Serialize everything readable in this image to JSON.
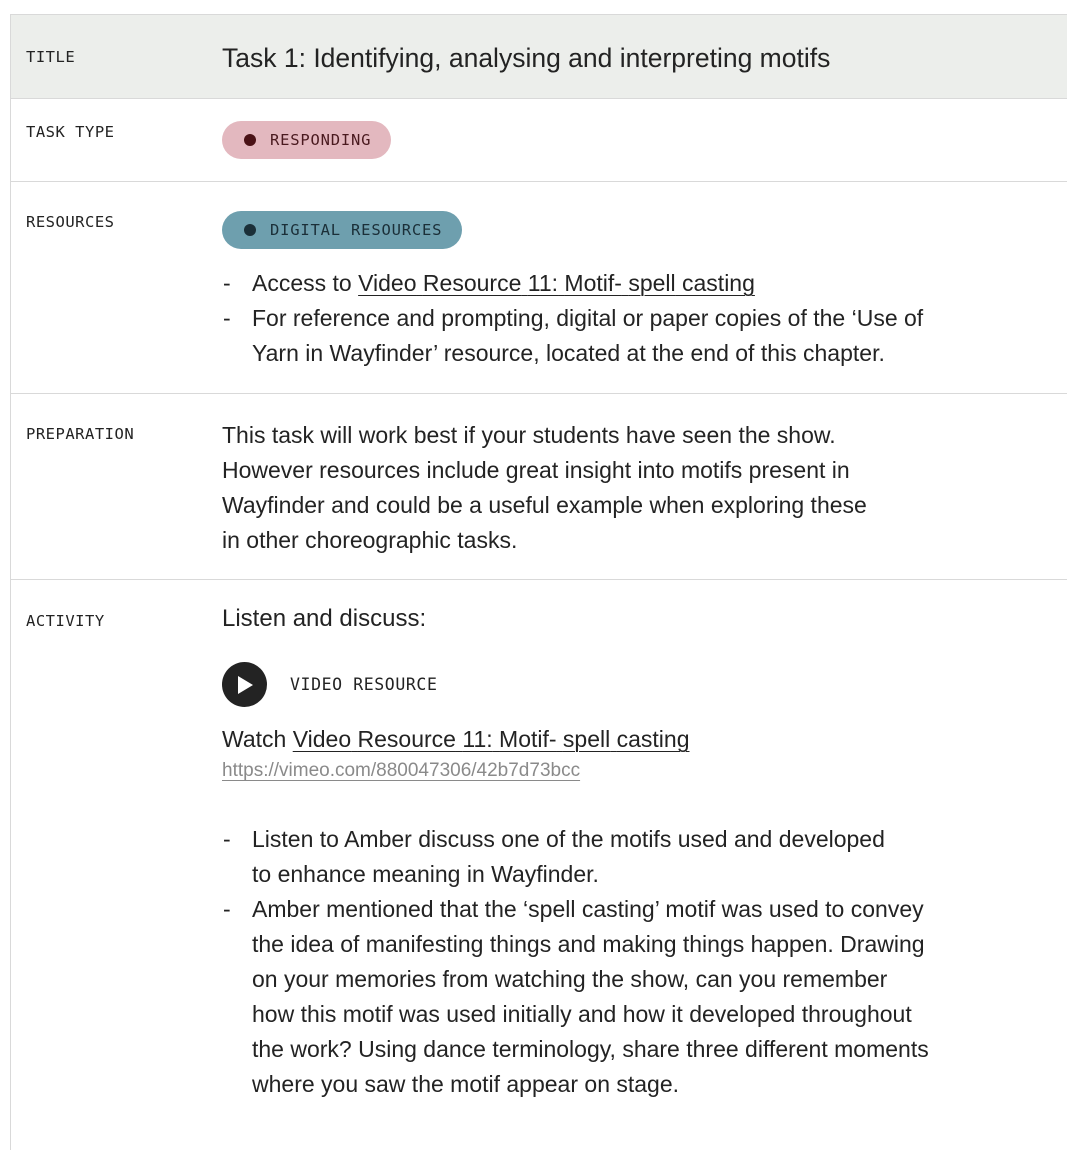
{
  "title": {
    "label": "TITLE",
    "text": "Task 1: Identifying, analysing and interpreting motifs"
  },
  "task_type": {
    "label": "TASK TYPE",
    "pill": "RESPONDING"
  },
  "resources": {
    "label": "RESOURCES",
    "pill": "DIGITAL RESOURCES",
    "item1_prefix": "Access to ",
    "item1_link_words": [
      "Video",
      "Resource",
      "11:",
      "Motif-",
      "spell",
      "casting"
    ],
    "item2_line1": "For reference and prompting, digital or paper copies of the ‘Use of",
    "item2_line2": "Yarn in Wayfinder’ resource, located at the end of this chapter."
  },
  "preparation": {
    "label": "PREPARATION",
    "lines": [
      "This task will work best if your students have seen the show.",
      "However resources include great insight into motifs present in",
      "Wayfinder and could be a useful example when exploring these",
      "in other choreographic tasks."
    ]
  },
  "activity": {
    "label": "ACTIVITY",
    "heading": "Listen and discuss:",
    "video_label": "VIDEO RESOURCE",
    "watch_prefix": "Watch ",
    "watch_link_words": [
      "Video",
      "Resource",
      "11:",
      "Motif-",
      "spell",
      "casting"
    ],
    "url": "https://vimeo.com/880047306/42b7d73bcc",
    "bullet1_lines": [
      "Listen to Amber discuss one of the motifs used and developed",
      "to enhance meaning in Wayfinder."
    ],
    "bullet2_lines": [
      "Amber mentioned that the ‘spell casting’ motif was used to convey",
      "the idea of manifesting things and making things happen. Drawing",
      "on your memories from watching the show, can you remember",
      "how this motif was used initially and how it developed throughout",
      "the work? Using dance terminology, share three different moments",
      "where you saw the motif appear on stage."
    ]
  },
  "dash": "-",
  "colors": {
    "title_bg": "#eceeeb",
    "responding_pill": "#e3b8bf",
    "digital_pill": "#6e9fae",
    "text": "#232323"
  },
  "icons": [
    "play-icon"
  ]
}
